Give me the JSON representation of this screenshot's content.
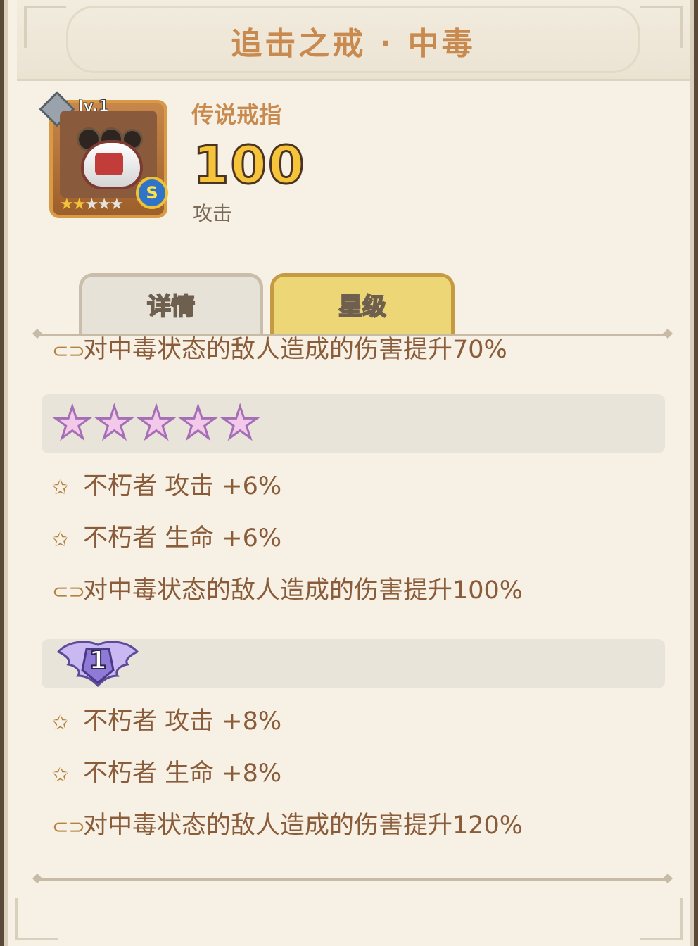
{
  "header": {
    "title": "追击之戒 · 中毒"
  },
  "item": {
    "level": "lv.1",
    "rarity": "传说戒指",
    "stat_value": "100",
    "stat_label": "攻击",
    "grade_badge": "S",
    "stars_filled": 2,
    "stars_total": 5,
    "icon": "ring-icon"
  },
  "tabs": [
    {
      "label": "详情",
      "active": false
    },
    {
      "label": "星级",
      "active": true
    }
  ],
  "tier_prev": {
    "lines": [
      {
        "icon": "link-icon",
        "text": "对中毒状态的敌人造成的伤害提升70%"
      }
    ]
  },
  "tier_five_star": {
    "badge": "five-rainbow-stars",
    "lines": [
      {
        "icon": "star-icon",
        "text": "不朽者 攻击 +6%"
      },
      {
        "icon": "star-icon",
        "text": "不朽者 生命 +6%"
      },
      {
        "icon": "link-icon",
        "text": "对中毒状态的敌人造成的伤害提升100%"
      }
    ]
  },
  "tier_wing_one": {
    "badge": "wing-badge",
    "badge_number": "1",
    "lines": [
      {
        "icon": "star-icon",
        "text": "不朽者 攻击 +8%"
      },
      {
        "icon": "star-icon",
        "text": "不朽者 生命 +8%"
      },
      {
        "icon": "link-icon",
        "text": "对中毒状态的敌人造成的伤害提升120%"
      }
    ]
  },
  "colors": {
    "panel_bg": "#f6f1e4",
    "title": "#c98a4f",
    "text": "#8a5c3a",
    "number_fill": "#f6c43b",
    "tab_active": "#ecd676",
    "tab_inactive": "#e7e2d8"
  }
}
